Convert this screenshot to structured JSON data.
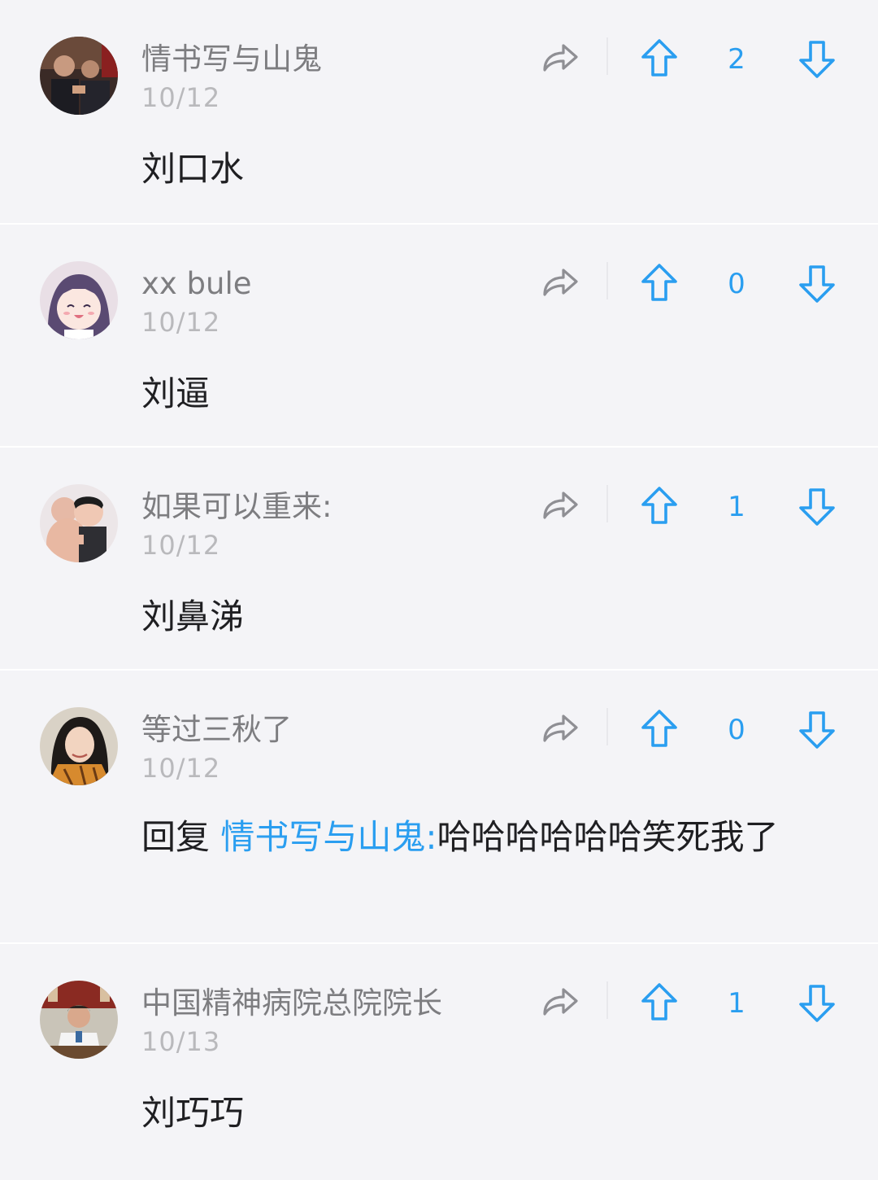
{
  "colors": {
    "accent": "#2a9ef0",
    "username": "#7d7d80",
    "date": "#b9b9bc",
    "text": "#1f1f22",
    "background": "#f4f4f7"
  },
  "icons": {
    "share": "share-arrow-icon",
    "upvote": "arrow-up-outline-icon",
    "downvote": "arrow-down-outline-icon"
  },
  "comments": [
    {
      "username": "情书写与山鬼",
      "date": "10/12",
      "votes": "2",
      "text": "刘口水"
    },
    {
      "username": "xx bule",
      "date": "10/12",
      "votes": "0",
      "text": "刘逼"
    },
    {
      "username": "如果可以重来:",
      "date": "10/12",
      "votes": "1",
      "text": "刘鼻涕"
    },
    {
      "username": "等过三秋了",
      "date": "10/12",
      "votes": "0",
      "reply_prefix": "回复",
      "reply_to": "情书写与山鬼:",
      "text": "哈哈哈哈哈哈笑死我了"
    },
    {
      "username": "中国精神病院总院院长",
      "date": "10/13",
      "votes": "1",
      "text": "刘巧巧"
    }
  ]
}
